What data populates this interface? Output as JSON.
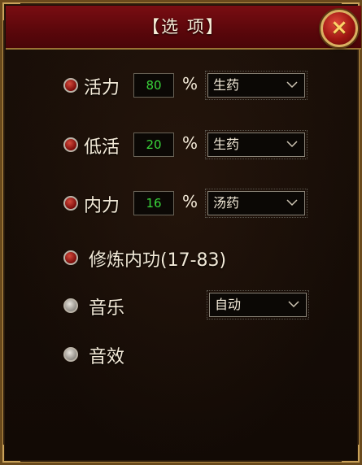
{
  "title": "【选 项】",
  "close_icon": "×",
  "rows": [
    {
      "label": "活力",
      "value": "80",
      "unit": "%",
      "select": "生药"
    },
    {
      "label": "低活",
      "value": "20",
      "unit": "%",
      "select": "生药"
    },
    {
      "label": "内力",
      "value": "16",
      "unit": "%",
      "select": "汤药"
    }
  ],
  "practice": {
    "label": "修炼内功(17-83)"
  },
  "music": {
    "label": "音乐",
    "select": "自动"
  },
  "sfx": {
    "label": "音效"
  },
  "colors": {
    "title_bar": "#6a0a0f",
    "frame_gold": "#c9a25a",
    "value_green": "#39d43a",
    "radio_on": "#b0201a",
    "radio_off": "#cfcbc4"
  }
}
